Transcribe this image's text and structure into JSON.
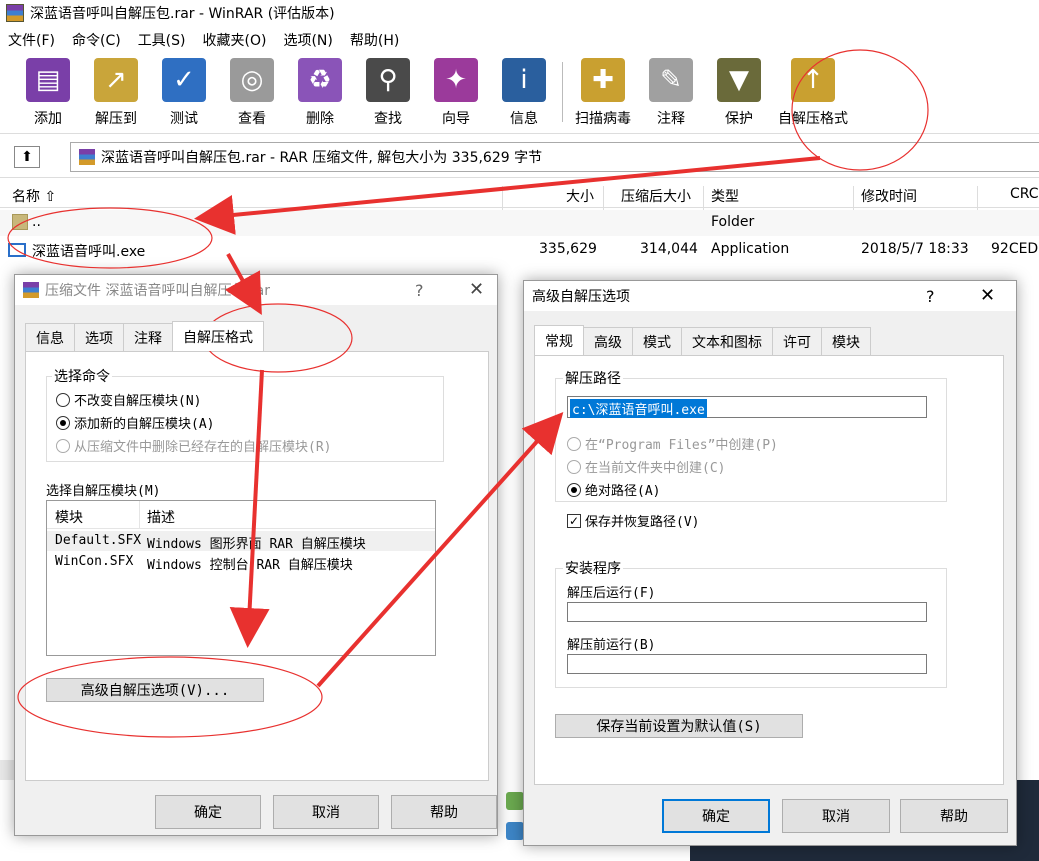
{
  "window": {
    "title": "深蓝语音呼叫自解压包.rar - WinRAR (评估版本)"
  },
  "menu": [
    "文件(F)",
    "命令(C)",
    "工具(S)",
    "收藏夹(O)",
    "选项(N)",
    "帮助(H)"
  ],
  "toolbar": [
    {
      "label": "添加",
      "icon": "add-archive-icon",
      "color": "#7a3fa8"
    },
    {
      "label": "解压到",
      "icon": "extract-to-icon",
      "color": "#c9a53a"
    },
    {
      "label": "测试",
      "icon": "test-icon",
      "color": "#2f6fc2"
    },
    {
      "label": "查看",
      "icon": "view-icon",
      "color": "#9a9a9a"
    },
    {
      "label": "删除",
      "icon": "delete-icon",
      "color": "#8a54b8"
    },
    {
      "label": "查找",
      "icon": "find-icon",
      "color": "#4a4a4a"
    },
    {
      "label": "向导",
      "icon": "wizard-icon",
      "color": "#9b3a9b"
    },
    {
      "label": "信息",
      "icon": "info-icon",
      "color": "#2a5f9e"
    },
    {
      "label": "扫描病毒",
      "icon": "scan-virus-icon",
      "color": "#c9a030"
    },
    {
      "label": "注释",
      "icon": "comment-icon",
      "color": "#a0a0a0"
    },
    {
      "label": "保护",
      "icon": "protect-icon",
      "color": "#6a6a3a"
    },
    {
      "label": "自解压格式",
      "icon": "sfx-icon",
      "color": "#c9a030"
    }
  ],
  "address": "深蓝语音呼叫自解压包.rar - RAR 压缩文件, 解包大小为 335,629 字节",
  "list": {
    "headers": [
      "名称",
      "大小",
      "压缩后大小",
      "类型",
      "修改时间",
      "CRC"
    ],
    "rows": [
      {
        "name": "..",
        "size": "",
        "packed": "",
        "type": "Folder",
        "modified": "",
        "crc": ""
      },
      {
        "name": "深蓝语音呼叫.exe",
        "size": "335,629",
        "packed": "314,044",
        "type": "Application",
        "modified": "2018/5/7 18:33",
        "crc": "92CED"
      }
    ]
  },
  "dialog1": {
    "title": "压缩文件 深蓝语音呼叫自解压包.rar",
    "help": "?",
    "tabs": [
      "信息",
      "选项",
      "注释",
      "自解压格式"
    ],
    "group_label": "选择命令",
    "radios": [
      "不改变自解压模块(N)",
      "添加新的自解压模块(A)",
      "从压缩文件中删除已经存在的自解压模块(R)"
    ],
    "module_label": "选择自解压模块(M)",
    "module_headers": [
      "模块",
      "描述"
    ],
    "modules": [
      {
        "name": "Default.SFX",
        "desc": "Windows 图形界面 RAR 自解压模块"
      },
      {
        "name": "WinCon.SFX",
        "desc": "Windows 控制台 RAR 自解压模块"
      }
    ],
    "advanced_button": "高级自解压选项(V)...",
    "ok": "确定",
    "cancel": "取消",
    "helpbtn": "帮助"
  },
  "dialog2": {
    "title": "高级自解压选项",
    "help": "?",
    "tabs": [
      "常规",
      "高级",
      "模式",
      "文本和图标",
      "许可",
      "模块"
    ],
    "path_group": "解压路径",
    "path_value": "c:\\深蓝语音呼叫.exe",
    "radios": [
      "在“Program Files”中创建(P)",
      "在当前文件夹中创建(C)",
      "绝对路径(A)"
    ],
    "checkbox": "保存并恢复路径(V)",
    "setup_group": "安装程序",
    "run_after": "解压后运行(F)",
    "run_before": "解压前运行(B)",
    "save_default": "保存当前设置为默认值(S)",
    "ok": "确定",
    "cancel": "取消",
    "helpbtn": "帮助"
  }
}
